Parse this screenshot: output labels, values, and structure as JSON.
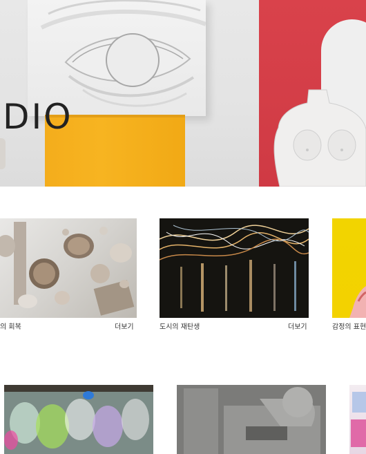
{
  "hero": {
    "wordmark": "DIO"
  },
  "gallery_row_1": [
    {
      "title": "의 회복",
      "more": "더보기"
    },
    {
      "title": "도시의 재탄생",
      "more": "더보기"
    },
    {
      "title": "감정의 표현"
    }
  ],
  "colors": {
    "hero_red": "#d9424b",
    "hero_yellow": "#f4ad1c",
    "text_dark": "#222222"
  }
}
